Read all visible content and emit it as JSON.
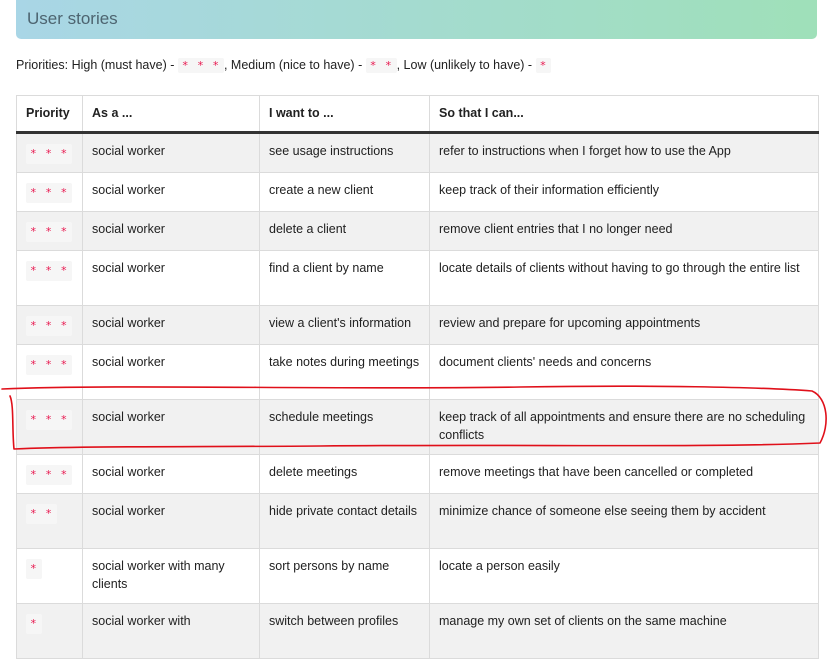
{
  "header": {
    "title": "User stories"
  },
  "legend": {
    "prefix": "Priorities: High (must have) -",
    "high_stars": "* * *",
    "medium_label": ", Medium (nice to have) -",
    "medium_stars": "* *",
    "low_label": ", Low (unlikely to have) -",
    "low_stars": "*"
  },
  "table": {
    "headers": [
      "Priority",
      "As a ...",
      "I want to ...",
      "So that I can..."
    ],
    "rows": [
      {
        "priority": "* * *",
        "role": "social worker",
        "want": "see usage instructions",
        "benefit": "refer to instructions when I forget how to use the App"
      },
      {
        "priority": "* * *",
        "role": "social worker",
        "want": "create a new client",
        "benefit": "keep track of their information efficiently"
      },
      {
        "priority": "* * *",
        "role": "social worker",
        "want": "delete a client",
        "benefit": "remove client entries that I no longer need"
      },
      {
        "priority": "* * *",
        "role": "social worker",
        "want": "find a client by name",
        "benefit": "locate details of clients without having to go through the entire list"
      },
      {
        "priority": "* * *",
        "role": "social worker",
        "want": "view a client's information",
        "benefit": "review and prepare for upcoming appointments"
      },
      {
        "priority": "* * *",
        "role": "social worker",
        "want": "take notes during meetings",
        "benefit": "document clients' needs and concerns"
      },
      {
        "priority": "* * *",
        "role": "social worker",
        "want": "schedule meetings",
        "benefit": "keep track of all appointments and ensure there are no scheduling conflicts"
      },
      {
        "priority": "* * *",
        "role": "social worker",
        "want": "delete meetings",
        "benefit": "remove meetings that have been cancelled or completed"
      },
      {
        "priority": "* *",
        "role": "social worker",
        "want": "hide private contact details",
        "benefit": "minimize chance of someone else seeing them by accident"
      },
      {
        "priority": "*",
        "role": "social worker with many clients",
        "want": "sort persons by name",
        "benefit": "locate a person easily"
      },
      {
        "priority": "*",
        "role": "social worker with",
        "want": "switch between profiles",
        "benefit": "manage my own set of clients on the same machine"
      }
    ]
  },
  "colors": {
    "stars": "#e8184f",
    "annotation": "#e0101a"
  }
}
